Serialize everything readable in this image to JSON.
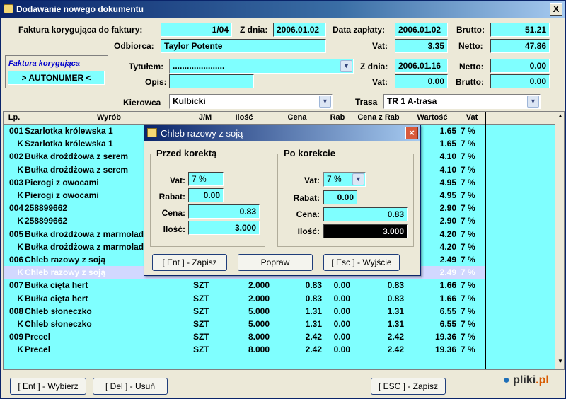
{
  "window": {
    "title": "Dodawanie nowego dokumentu",
    "close": "X"
  },
  "header": {
    "invoice_label": "Faktura korygująca do faktury:",
    "invoice_value": "1/04",
    "date_label": "Z dnia:",
    "date_value": "2006.01.02",
    "payment_label": "Data zapłaty:",
    "payment_value": "2006.01.02",
    "brutto_label": "Brutto:",
    "brutto_value": "51.21",
    "recipient_label": "Odbiorca:",
    "recipient_value": "Taylor Potente",
    "vat_label": "Vat:",
    "vat_value": "3.35",
    "netto_label": "Netto:",
    "netto_value": "47.86"
  },
  "correction": {
    "link": "Faktura korygująca",
    "autonumber": "> AUTONUMER <",
    "title_label": "Tytułem:",
    "title_value": "......................",
    "desc_label": "Opis:",
    "desc_value": "",
    "date_label": "Z dnia:",
    "date_value": "2006.01.16",
    "netto_label": "Netto:",
    "netto_value": "0.00",
    "vat_label": "Vat:",
    "vat_value": "0.00",
    "brutto_label": "Brutto:",
    "brutto_value": "0.00"
  },
  "driver": {
    "label": "Kierowca",
    "value": "Kulbicki"
  },
  "route": {
    "label": "Trasa",
    "value": "TR 1  A-trasa"
  },
  "columns": [
    "Lp.",
    "Wyrób",
    "J/M",
    "Ilość",
    "Cena",
    "Rab",
    "Cena z Rab",
    "Wartość",
    "Vat"
  ],
  "rows": [
    [
      "001",
      "Szarlotka królewska  1",
      "",
      "",
      "",
      "",
      "",
      "1.65",
      "7 %"
    ],
    [
      "K",
      "Szarlotka królewska  1",
      "",
      "",
      "",
      "",
      "",
      "1.65",
      "7 %"
    ],
    [
      "002",
      "Bułka drożdżowa z serem",
      "",
      "",
      "",
      "",
      "",
      "4.10",
      "7 %"
    ],
    [
      "K",
      "Bułka drożdżowa z serem",
      "",
      "",
      "",
      "",
      "",
      "4.10",
      "7 %"
    ],
    [
      "003",
      "Pierogi z owocami",
      "",
      "",
      "",
      "",
      "",
      "4.95",
      "7 %"
    ],
    [
      "K",
      "Pierogi z owocami",
      "",
      "",
      "",
      "",
      "",
      "4.95",
      "7 %"
    ],
    [
      "004",
      "258899662",
      "",
      "",
      "",
      "",
      "",
      "2.90",
      "7 %"
    ],
    [
      "K",
      "258899662",
      "",
      "",
      "",
      "",
      "",
      "2.90",
      "7 %"
    ],
    [
      "005",
      "Bułka drożdżowa z marmolad",
      "",
      "",
      "",
      "",
      "",
      "4.20",
      "7 %"
    ],
    [
      "K",
      "Bułka drożdżowa z marmolad",
      "",
      "",
      "",
      "",
      "",
      "4.20",
      "7 %"
    ],
    [
      "006",
      "Chleb razowy z soją",
      "",
      "",
      "",
      "",
      "",
      "2.49",
      "7 %"
    ],
    [
      "K",
      "Chleb razowy z soją",
      "",
      "",
      "",
      "",
      "",
      "2.49",
      "7 %"
    ],
    [
      "007",
      "Bułka cięta hert",
      "SZT",
      "2.000",
      "0.83",
      "0.00",
      "0.83",
      "1.66",
      "7 %"
    ],
    [
      "K",
      "Bułka cięta hert",
      "SZT",
      "2.000",
      "0.83",
      "0.00",
      "0.83",
      "1.66",
      "7 %"
    ],
    [
      "008",
      "Chleb słoneczko",
      "SZT",
      "5.000",
      "1.31",
      "0.00",
      "1.31",
      "6.55",
      "7 %"
    ],
    [
      "K",
      "Chleb słoneczko",
      "SZT",
      "5.000",
      "1.31",
      "0.00",
      "1.31",
      "6.55",
      "7 %"
    ],
    [
      "009",
      "Precel",
      "SZT",
      "8.000",
      "2.42",
      "0.00",
      "2.42",
      "19.36",
      "7 %"
    ],
    [
      "K",
      "Precel",
      "SZT",
      "8.000",
      "2.42",
      "0.00",
      "2.42",
      "19.36",
      "7 %"
    ]
  ],
  "selected_row": 11,
  "buttons": {
    "select": "[ Ent ] - Wybierz",
    "delete": "[ Del ] - Usuń",
    "save": "[ ESC ] - Zapisz"
  },
  "logo": {
    "text": "pliki",
    "tld": ".pl"
  },
  "dialog": {
    "title": "Chleb razowy z soją",
    "before": {
      "title": "Przed korektą",
      "vat_label": "Vat:",
      "vat": "7 %",
      "rabat_label": "Rabat:",
      "rabat": "0.00",
      "cena_label": "Cena:",
      "cena": "0.83",
      "ilosc_label": "Ilość:",
      "ilosc": "3.000"
    },
    "after": {
      "title": "Po korekcie",
      "vat_label": "Vat:",
      "vat": "7 %",
      "rabat_label": "Rabat:",
      "rabat": "0.00",
      "cena_label": "Cena:",
      "cena": "0.83",
      "ilosc_label": "Ilość:",
      "ilosc": "3.000"
    },
    "buttons": {
      "save": "[ Ent ] - Zapisz",
      "fix": "Popraw",
      "exit": "[ Esc ] - Wyjście"
    }
  },
  "colors": {
    "field": "#7fffff",
    "title_start": "#0a246a",
    "title_end": "#a6caf0",
    "selected_row": "#d2d8ff"
  }
}
